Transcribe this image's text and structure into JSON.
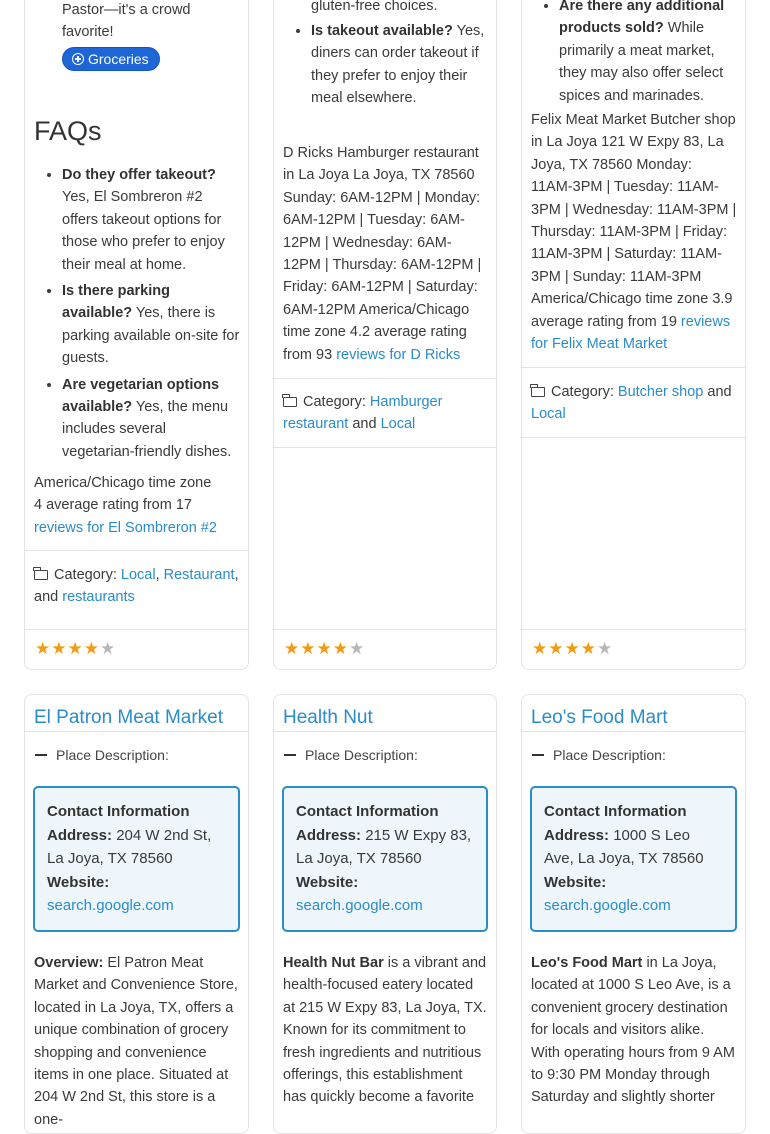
{
  "col1": {
    "intro_text": "Pastor—it's a crowd favorite!",
    "tag": "Groceries",
    "faq_heading": "FAQs",
    "faqs": [
      {
        "q": "Do they offer takeout?",
        "a": "Yes, El Sombreron #2 offers takeout options for those who prefer to enjoy their meal at home."
      },
      {
        "q": "Is there parking available?",
        "a": "Yes, there is parking available on-site for guests."
      },
      {
        "q": "Are vegetarian options available?",
        "a": "Yes, the menu includes several vegetarian-friendly dishes."
      }
    ],
    "summary_text": "America/Chicago time zone 4 average rating from 17",
    "reviews_link": "reviews for El Sombreron #2",
    "category_label": "Category:",
    "categories": [
      "Local",
      "Restaurant",
      "restaurants"
    ],
    "sep_comma": ",",
    "sep_and": "and",
    "rating": 4
  },
  "col2": {
    "top_fragment": "gluten-free choices.",
    "faqs": [
      {
        "q": "Is takeout available?",
        "a": "Yes, diners can order takeout if they prefer to enjoy their meal elsewhere."
      }
    ],
    "summary_text": "D Ricks Hamburger restaurant in La Joya La Joya, TX 78560 Sunday: 6AM-12PM | Monday: 6AM-12PM | Tuesday: 6AM-12PM | Wednesday: 6AM-12PM | Thursday: 6AM-12PM | Friday: 6AM-12PM | Saturday: 6AM-12PM America/Chicago time zone 4.2 average rating from 93",
    "reviews_link": "reviews for D Ricks",
    "category_label": "Category:",
    "categories": [
      "Hamburger restaurant",
      "Local"
    ],
    "sep_and": "and",
    "rating": 4.2
  },
  "col3": {
    "faqs": [
      {
        "q": "Are there any additional products sold?",
        "a": "While primarily a meat market, they may also offer select spices and marinades."
      }
    ],
    "summary_text": "Felix Meat Market Butcher shop in La Joya 121 W Expy 83, La Joya, TX 78560 Monday: 11AM-3PM | Tuesday: 11AM-3PM | Wednesday: 11AM-3PM | Thursday: 11AM-3PM | Friday: 11AM-3PM | Saturday: 11AM-3PM | Sunday: 11AM-3PM America/Chicago time zone 3.9 average rating from 19",
    "reviews_link": "reviews for Felix Meat Market",
    "category_label": "Category:",
    "categories": [
      "Butcher shop",
      "Local"
    ],
    "sep_and": "and",
    "rating": 3.9
  },
  "listings": [
    {
      "title": "El Patron Meat Market",
      "place_description_label": "Place Description:",
      "contact_heading": "Contact Information",
      "address_label": "Address:",
      "address": "204 W 2nd St, La Joya, TX 78560",
      "website_label": "Website:",
      "website": "search.google.com",
      "overview_lead": "Overview:",
      "overview": "El Patron Meat Market and Convenience Store, located in La Joya, TX, offers a unique combination of grocery shopping and convenience items in one place. Situated at 204 W 2nd St, this store is a one-"
    },
    {
      "title": "Health Nut",
      "place_description_label": "Place Description:",
      "contact_heading": "Contact Information",
      "address_label": "Address:",
      "address": "215 W Expy 83, La Joya, TX 78560",
      "website_label": "Website:",
      "website": "search.google.com",
      "overview_lead": "Health Nut Bar",
      "overview": "is a vibrant and health-focused eatery located at 215 W Expy 83, La Joya, TX. Known for its commitment to fresh ingredients and nutritious offerings, this establishment has quickly become a favorite"
    },
    {
      "title": "Leo's Food Mart",
      "place_description_label": "Place Description:",
      "contact_heading": "Contact Information",
      "address_label": "Address:",
      "address": "1000 S Leo Ave, La Joya, TX 78560",
      "website_label": "Website:",
      "website": "search.google.com",
      "overview_lead": "Leo's Food Mart",
      "overview": "in La Joya, located at 1000 S Leo Ave, is a convenient grocery destination for locals and visitors alike. With operating hours from 9 AM to 9:30 PM Monday through Saturday and slightly shorter"
    }
  ]
}
